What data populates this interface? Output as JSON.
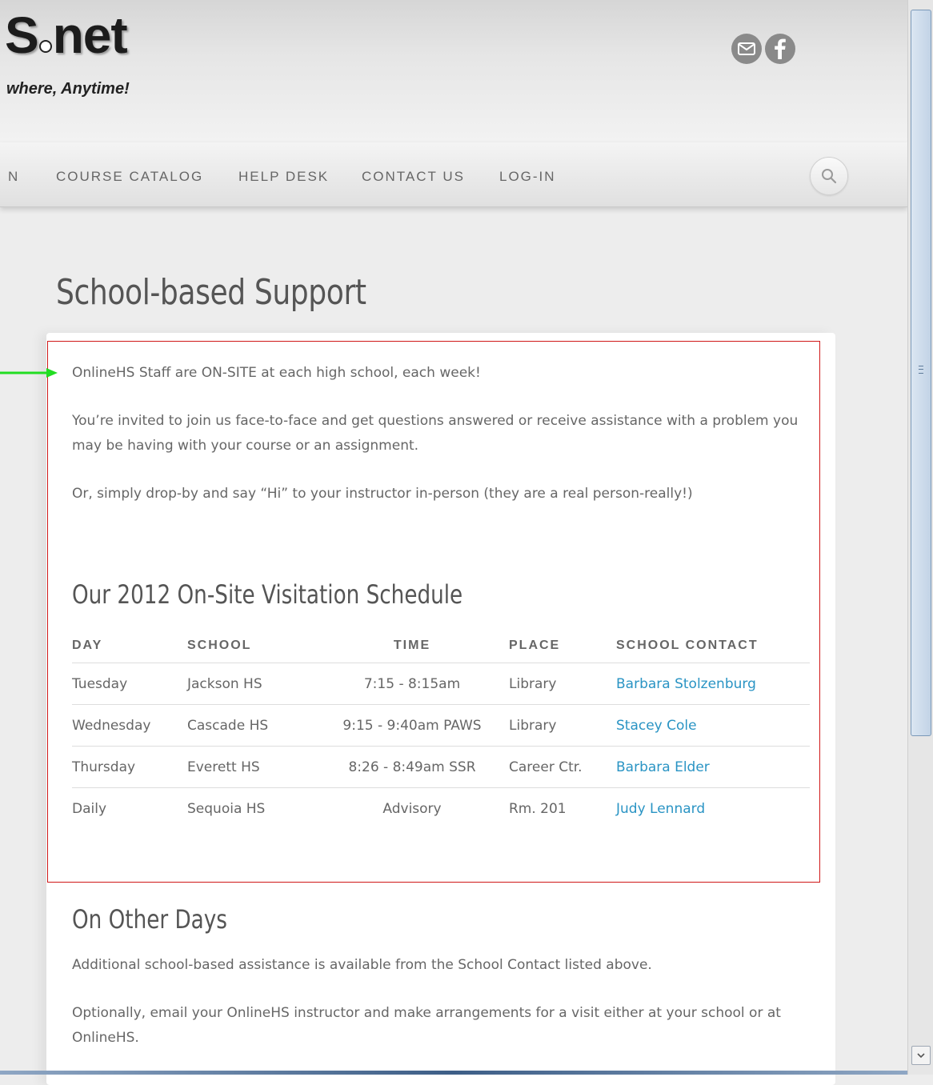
{
  "header": {
    "logo_text": "S",
    "logo_suffix": "net",
    "tagline": "where, Anytime!",
    "social_icons": [
      "email-icon",
      "facebook-icon"
    ]
  },
  "nav": {
    "items": [
      {
        "label": "N"
      },
      {
        "label": "COURSE CATALOG"
      },
      {
        "label": "HELP DESK"
      },
      {
        "label": "CONTACT US"
      },
      {
        "label": "LOG-IN"
      }
    ],
    "search_icon": "search-icon"
  },
  "page": {
    "title": "School-based Support",
    "intro": [
      "OnlineHS Staff are ON-SITE at each high school, each week!",
      "You’re invited to join us face-to-face and get questions answered or receive assistance with a problem you may be having with your course or an assignment.",
      "Or, simply drop-by and say “Hi” to your instructor in-person (they are a real person-really!)"
    ],
    "schedule": {
      "title": "Our 2012 On-Site Visitation Schedule",
      "columns": [
        "DAY",
        "SCHOOL",
        "TIME",
        "PLACE",
        "SCHOOL CONTACT"
      ],
      "rows": [
        {
          "day": "Tuesday",
          "school": "Jackson HS",
          "time": "7:15 - 8:15am",
          "place": "Library",
          "contact": "Barbara Stolzenburg"
        },
        {
          "day": "Wednesday",
          "school": "Cascade HS",
          "time": "9:15 - 9:40am PAWS",
          "place": "Library",
          "contact": "Stacey Cole"
        },
        {
          "day": "Thursday",
          "school": "Everett HS",
          "time": "8:26 - 8:49am SSR",
          "place": "Career Ctr.",
          "contact": "Barbara Elder"
        },
        {
          "day": "Daily",
          "school": "Sequoia HS",
          "time": "Advisory",
          "place": "Rm. 201",
          "contact": "Judy Lennard"
        }
      ]
    },
    "other_days": {
      "title": "On Other Days",
      "paragraphs": [
        "Additional school-based assistance is available from the School Contact listed above.",
        "Optionally, email your OnlineHS instructor and make arrangements for a visit either at your school or at OnlineHS."
      ]
    }
  },
  "annotation": {
    "arrow_color": "#22dd22",
    "box_color": "#d01818"
  },
  "colors": {
    "link": "#2a94c4",
    "text": "#666666"
  }
}
